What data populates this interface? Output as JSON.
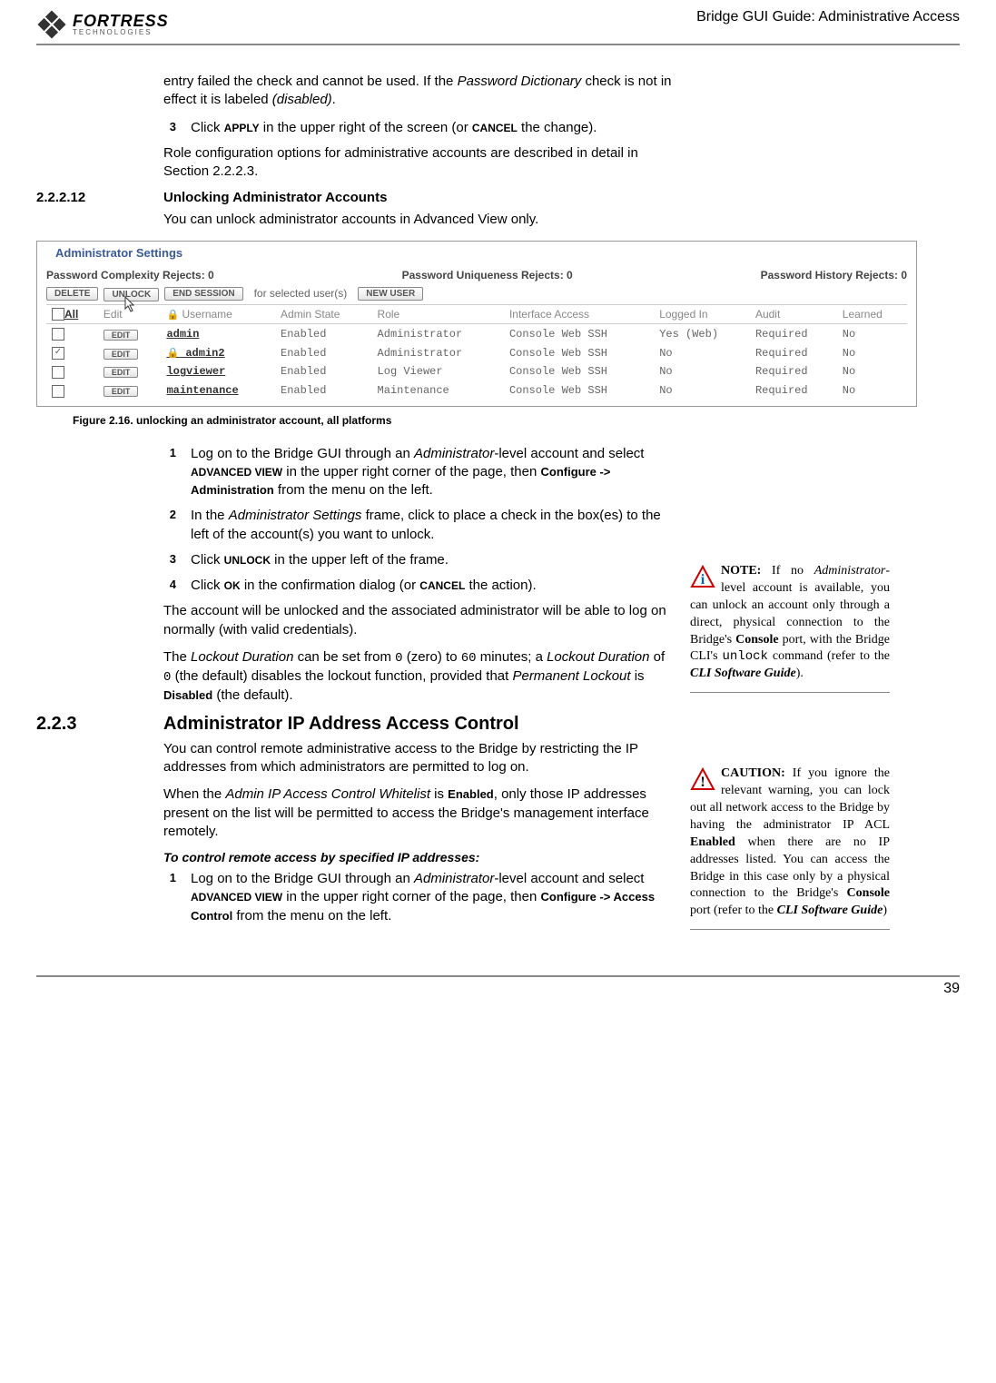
{
  "header": {
    "logo_main": "FORTRESS",
    "logo_sub": "TECHNOLOGIES",
    "right": "Bridge GUI Guide: Administrative Access"
  },
  "intro_para": "entry failed the check and cannot be used. If the ",
  "intro_para_i1": "Password Dictionary",
  "intro_para2": " check is not in effect it is labeled ",
  "intro_para_i2": "(disabled)",
  "intro_para3": ".",
  "step3_pre": "Click ",
  "step3_b1": "APPLY",
  "step3_mid": " in the upper right of the screen (or ",
  "step3_b2": "CANCEL",
  "step3_end": " the change).",
  "role_para": "Role configuration options for administrative accounts are described in detail in Section 2.2.2.3.",
  "sec_12_num": "2.2.2.12",
  "sec_12_title": "Unlocking Administrator Accounts",
  "sec_12_body": "You can unlock administrator accounts in Advanced View only.",
  "screenshot": {
    "legend": "Administrator Settings",
    "rej1": "Password Complexity Rejects: 0",
    "rej2": "Password Uniqueness Rejects: 0",
    "rej3": "Password History Rejects: 0",
    "btn_delete": "DELETE",
    "btn_unlock": "UNLOCK",
    "btn_end": "END SESSION",
    "sel_text": "for selected user(s)",
    "btn_new": "NEW USER",
    "cols": {
      "all": "All",
      "edit": "Edit",
      "user": "Username",
      "state": "Admin State",
      "role": "Role",
      "iface": "Interface Access",
      "logged": "Logged In",
      "audit": "Audit",
      "learned": "Learned"
    },
    "rows": [
      {
        "checked": false,
        "locked": false,
        "user": "admin",
        "state": "Enabled",
        "role": "Administrator",
        "iface": "Console Web SSH",
        "logged": "Yes (Web)",
        "audit": "Required",
        "learned": "No"
      },
      {
        "checked": true,
        "locked": true,
        "user": "admin2",
        "state": "Enabled",
        "role": "Administrator",
        "iface": "Console Web SSH",
        "logged": "No",
        "audit": "Required",
        "learned": "No"
      },
      {
        "checked": false,
        "locked": false,
        "user": "logviewer",
        "state": "Enabled",
        "role": "Log Viewer",
        "iface": "Console Web SSH",
        "logged": "No",
        "audit": "Required",
        "learned": "No"
      },
      {
        "checked": false,
        "locked": false,
        "user": "maintenance",
        "state": "Enabled",
        "role": "Maintenance",
        "iface": "Console Web SSH",
        "logged": "No",
        "audit": "Required",
        "learned": "No"
      }
    ],
    "edit_btn": "EDIT"
  },
  "caption": "Figure 2.16. unlocking an administrator account, all platforms",
  "steps_b": [
    {
      "n": "1",
      "html": "Log on to the Bridge GUI through an <span class='italic'>Administrator</span>-level account and select <span class='smallcaps'>ADVANCED VIEW</span> in the upper right corner of the page, then <span class='bold-sans'>Configure -> Administration</span> from the menu on the left."
    },
    {
      "n": "2",
      "html": "In the <span class='italic'>Administrator Settings</span> frame, click to place a check in the box(es) to the left of the account(s) you want to unlock."
    },
    {
      "n": "3",
      "html": "Click <span class='smallcaps'>UNLOCK</span> in the upper left of the frame."
    },
    {
      "n": "4",
      "html": "Click <span class='smallcaps'>OK</span> in the confirmation dialog (or <span class='smallcaps'>CANCEL</span> the action)."
    }
  ],
  "after_steps_p1": "The account will be unlocked and the associated administrator will be able to log on normally (with valid credentials).",
  "after_steps_p2_html": "The <span class='italic'>Lockout Duration</span> can be set from <span class='mono'>0</span> (zero) to <span class='mono'>60</span> minutes; a <span class='italic'>Lockout Duration</span> of <span class='mono'>0</span> (the default) disables the lockout function, provided that <span class='italic'>Permanent Lockout</span> is <span class='bold-sans'>Disabled</span> (the default).",
  "sec_223_num": "2.2.3",
  "sec_223_title": "Administrator IP Address Access Control",
  "sec_223_p1": "You can control remote administrative access to the Bridge by restricting the IP addresses from which administrators are permitted to log on.",
  "sec_223_p2_html": "When the <span class='italic'>Admin IP Access Control Whitelist</span> is <span class='bold-sans'>Enabled</span>, only those IP addresses present on the list will be permitted to access the Bridge's management interface remotely.",
  "sec_223_sub": "To control remote access by specified IP addresses:",
  "sec_223_step1_html": "Log on to the Bridge GUI through an <span class='italic'>Administrator</span>-level account and select <span class='smallcaps'>ADVANCED VIEW</span> in the upper right corner of the page, then <span class='bold-sans'>Configure -> Access Control</span> from the menu on the left.",
  "note": {
    "label": "NOTE:",
    "html": " If no <span class='serif-ital'>Admin&shy;istrator</span>-level ac&shy;count is available, you can unlock an account only through a direct, physical connection to the Bridge's <span class='serif-bold'>Console</span> port, with the Bridge CLI's <span class='mono'>unlock</span> command (refer to the <span class='serif-ital serif-bold'>CLI Soft&shy;ware Guide</span>)."
  },
  "caution": {
    "label": "CAUTION:",
    "html": " If you ignore the relevant warning, you can lock out all network access to the Bridge by having the administrator IP ACL <span class='serif-bold'>Enabled</span> when there are no IP addresses listed. You can access the Bridge in this case only by a physical connection to the Bridge's <span class='serif-bold'>Console</span> port (refer to the <span class='serif-ital serif-bold'>CLI Software Guide</span>)"
  },
  "page_number": "39"
}
